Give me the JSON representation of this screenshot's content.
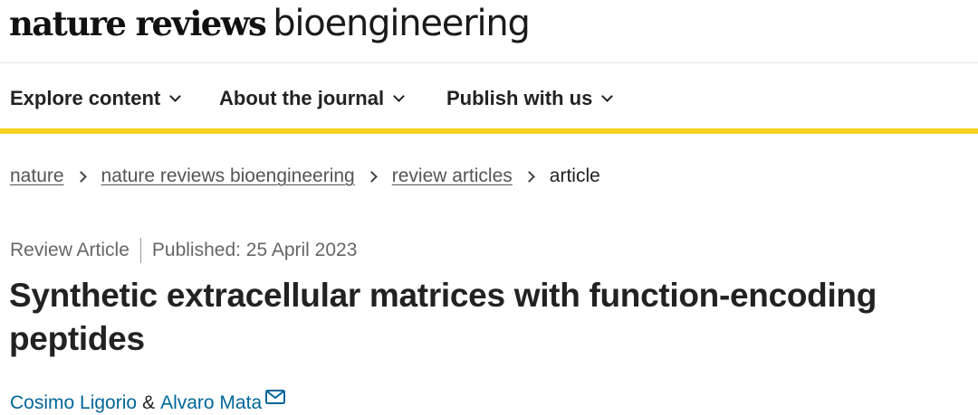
{
  "masthead": {
    "logo_bold": "nature reviews",
    "logo_light": "bioengineering"
  },
  "nav": {
    "items": [
      {
        "label": "Explore content",
        "icon": "chevron-down-icon"
      },
      {
        "label": "About the journal",
        "icon": "chevron-down-icon"
      },
      {
        "label": "Publish with us",
        "icon": "chevron-down-icon"
      }
    ],
    "accent_color": "#f6d31f"
  },
  "breadcrumb": {
    "items": [
      {
        "label": "nature",
        "link": true
      },
      {
        "label": "nature reviews bioengineering",
        "link": true
      },
      {
        "label": "review articles",
        "link": true
      },
      {
        "label": "article",
        "link": false
      }
    ],
    "separator_icon": "chevron-right-icon"
  },
  "article": {
    "type": "Review Article",
    "published": "Published: 25 April 2023",
    "title": "Synthetic extracellular matrices with function-encoding peptides",
    "authors": [
      {
        "name": "Cosimo Ligorio"
      },
      {
        "name": "Alvaro Mata",
        "icon": "mail-icon"
      }
    ],
    "author_separator": "&",
    "link_color": "#006699"
  }
}
